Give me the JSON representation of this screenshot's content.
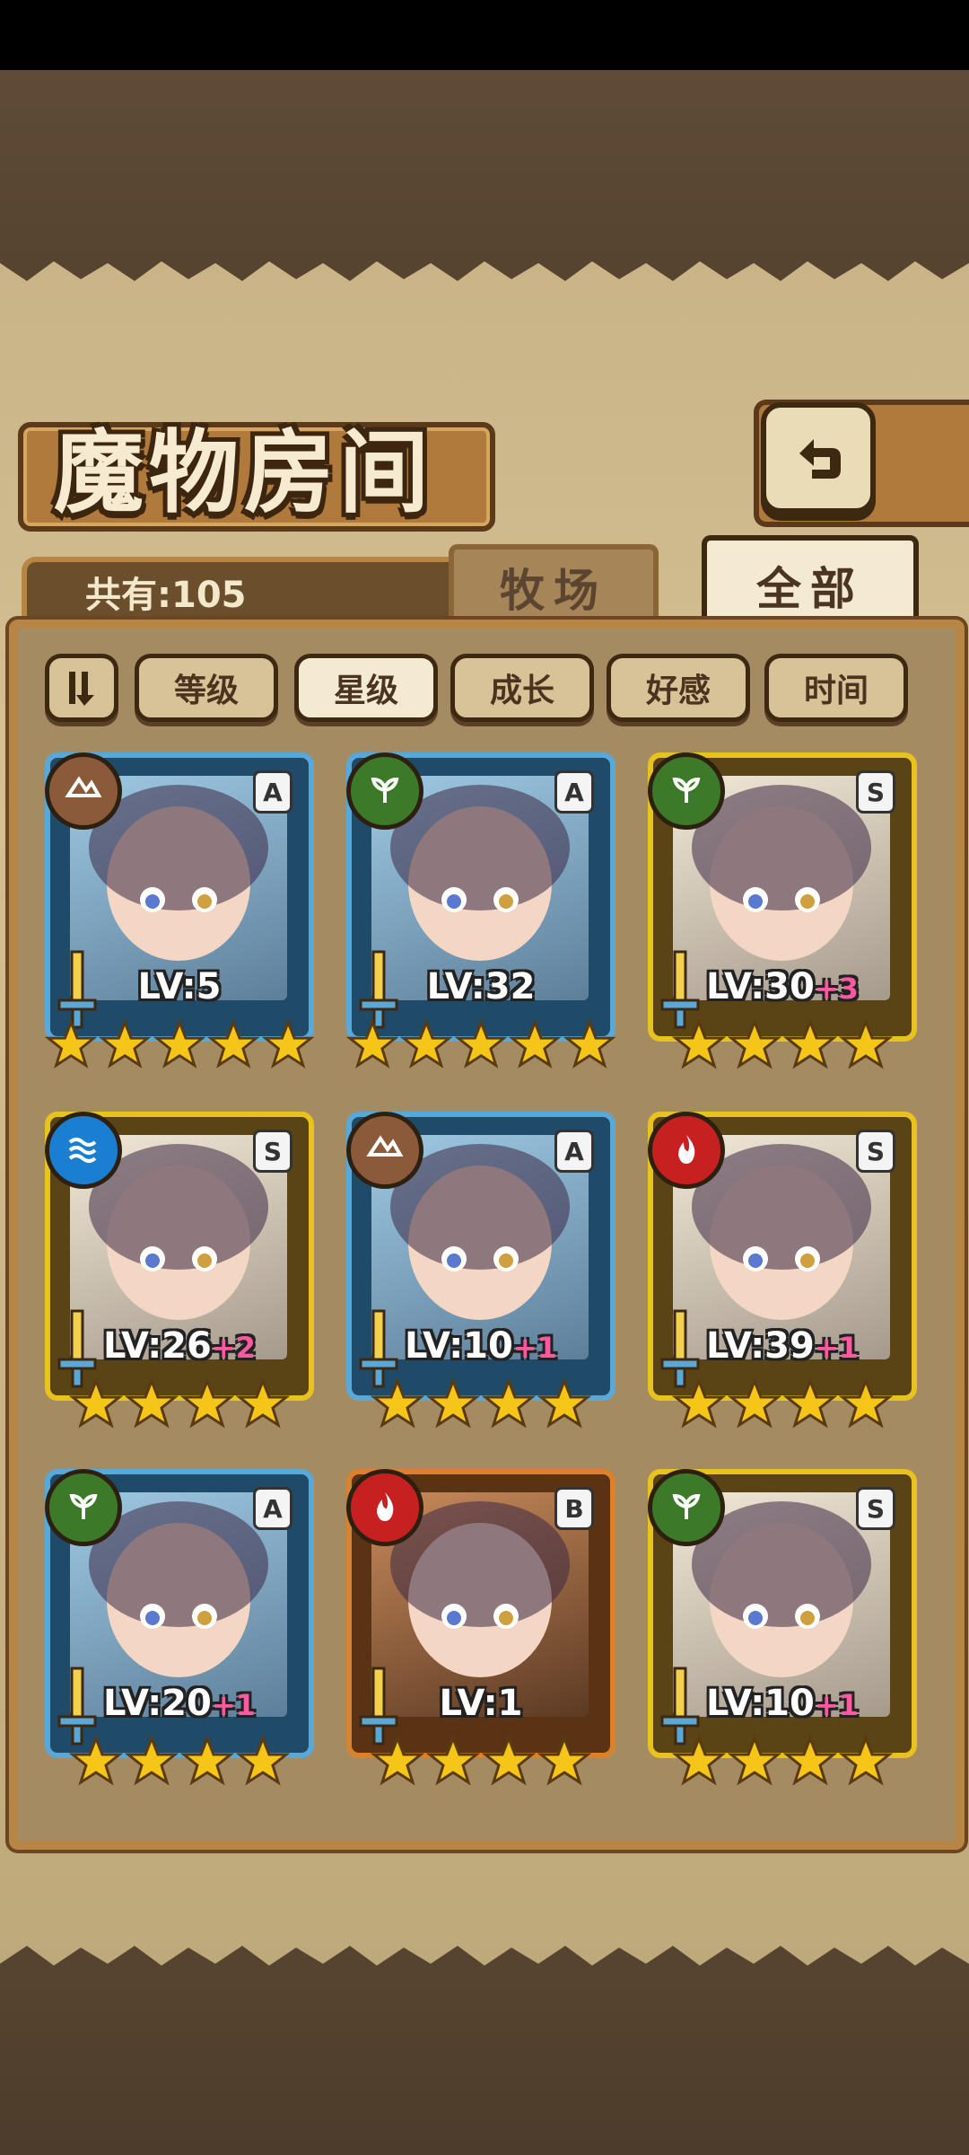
{
  "title": "魔物房间",
  "count_label": "共有:105",
  "tabs": {
    "pasture": "牧场",
    "all": "全部"
  },
  "filters": [
    "等级",
    "星级",
    "成长",
    "好感",
    "时间"
  ],
  "active_filter": "星级",
  "monsters": [
    {
      "level": "LV:5",
      "bonus": "",
      "rank": "A",
      "element": "earth",
      "stars": 5,
      "frame": "blue"
    },
    {
      "level": "LV:32",
      "bonus": "",
      "rank": "A",
      "element": "wood",
      "stars": 5,
      "frame": "blue"
    },
    {
      "level": "LV:30",
      "bonus": "+3",
      "rank": "S",
      "element": "wood",
      "stars": 4,
      "frame": "gold"
    },
    {
      "level": "LV:26",
      "bonus": "+2",
      "rank": "S",
      "element": "water",
      "stars": 4,
      "frame": "gold"
    },
    {
      "level": "LV:10",
      "bonus": "+1",
      "rank": "A",
      "element": "earth",
      "stars": 4,
      "frame": "blue"
    },
    {
      "level": "LV:39",
      "bonus": "+1",
      "rank": "S",
      "element": "fire",
      "stars": 4,
      "frame": "gold"
    },
    {
      "level": "LV:20",
      "bonus": "+1",
      "rank": "A",
      "element": "wood",
      "stars": 4,
      "frame": "blue"
    },
    {
      "level": "LV:1",
      "bonus": "",
      "rank": "B",
      "element": "fire",
      "stars": 4,
      "frame": "orange"
    },
    {
      "level": "LV:10",
      "bonus": "+1",
      "rank": "S",
      "element": "wood",
      "stars": 4,
      "frame": "gold"
    }
  ],
  "colors": {
    "frame_blue": "#5aa8d8",
    "frame_gold": "#e8c21e",
    "frame_orange": "#d9822b",
    "element_earth": "#8a5a3a",
    "element_wood": "#3c7a2a",
    "element_water": "#1a7fd0",
    "element_fire": "#c62020",
    "star": "#f5c518"
  }
}
